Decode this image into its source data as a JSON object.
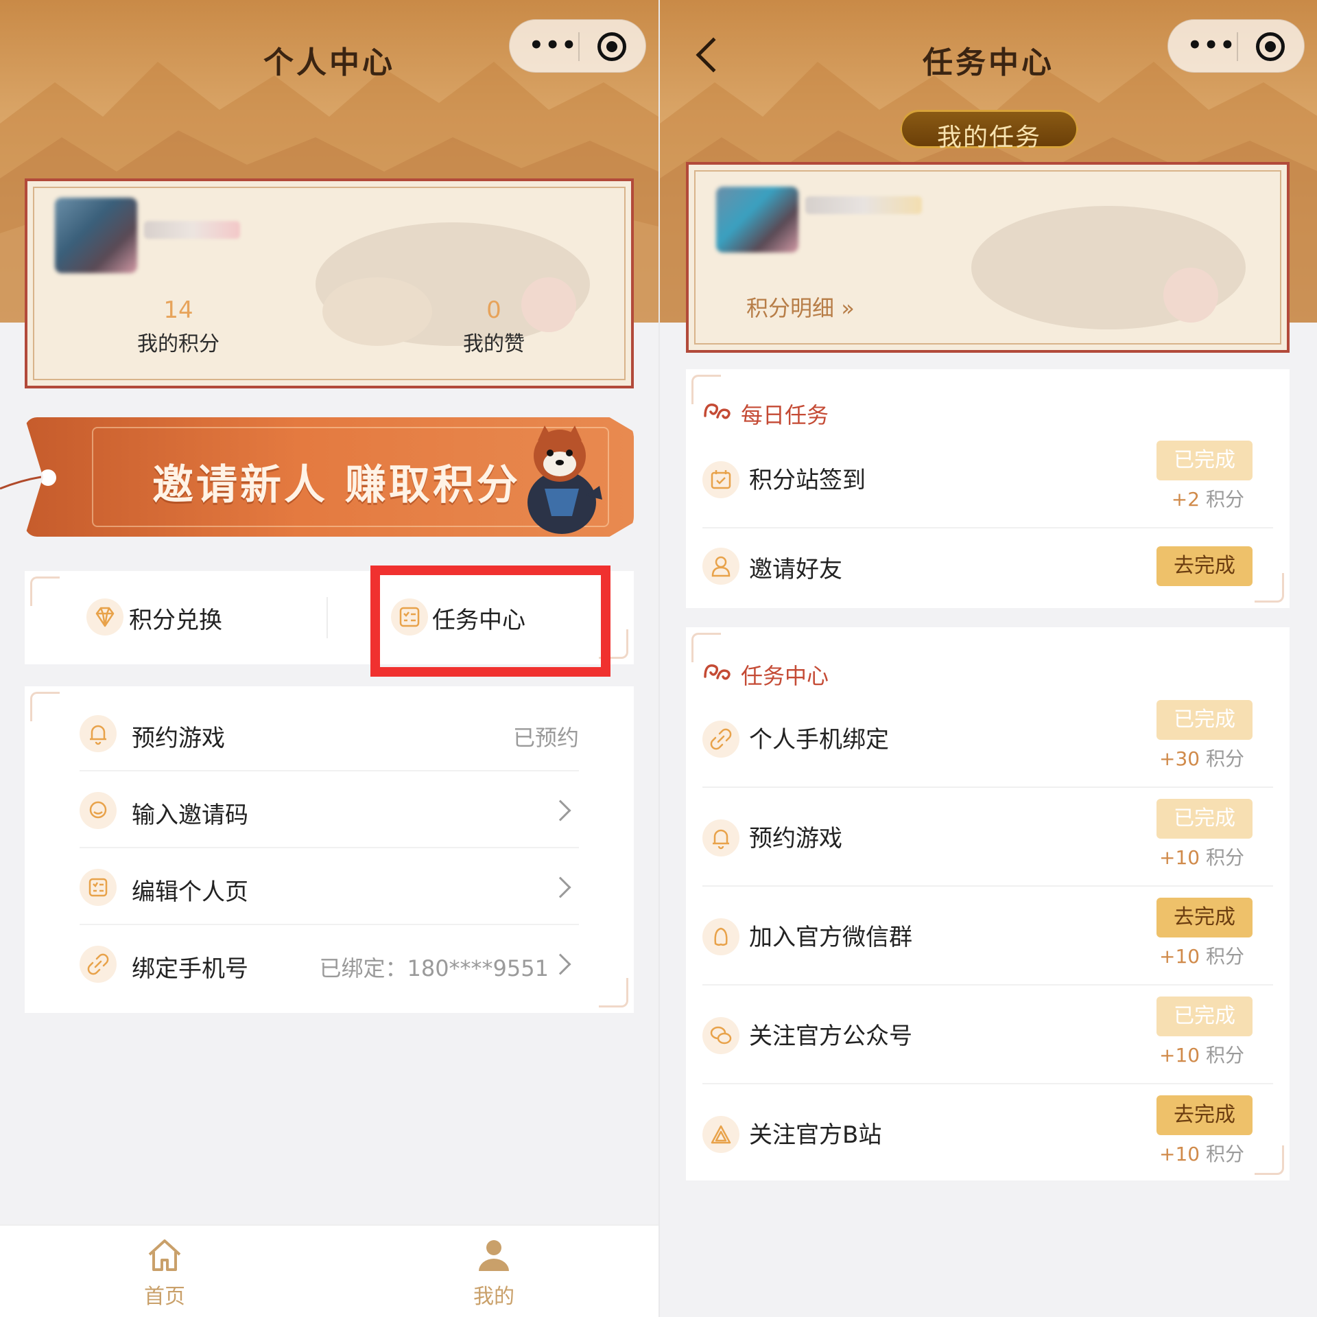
{
  "left": {
    "nav_title": "个人中心",
    "stats": [
      {
        "value": "14",
        "label": "我的积分"
      },
      {
        "value": "0",
        "label": "我的赞"
      }
    ],
    "banner_text": "邀请新人  赚取积分",
    "quick_actions": [
      {
        "label": "积分兑换",
        "icon": "diamond-icon"
      },
      {
        "label": "任务中心",
        "icon": "task-list-icon"
      }
    ],
    "menu": [
      {
        "label": "预约游戏",
        "value": "已预约",
        "icon": "bell-icon",
        "chevron": false
      },
      {
        "label": "输入邀请码",
        "value": "",
        "icon": "chat-bubble-icon",
        "chevron": true
      },
      {
        "label": "编辑个人页",
        "value": "",
        "icon": "edit-list-icon",
        "chevron": true
      },
      {
        "label": "绑定手机号",
        "value": "已绑定：180****9551",
        "icon": "link-icon",
        "chevron": true
      }
    ],
    "tabs": [
      {
        "label": "首页",
        "icon": "home-icon"
      },
      {
        "label": "我的",
        "icon": "user-icon"
      }
    ]
  },
  "right": {
    "nav_title": "任务中心",
    "badge": "我的任务",
    "detail_link": "积分明细",
    "detail_chevrons": "»",
    "daily": {
      "title": "每日任务",
      "tasks": [
        {
          "name": "积分站签到",
          "status": "已完成",
          "state": "done",
          "points": "+2",
          "unit": "积分",
          "icon": "calendar-check-icon"
        },
        {
          "name": "邀请好友",
          "status": "去完成",
          "state": "todo",
          "points": "",
          "unit": "",
          "icon": "user-icon"
        }
      ]
    },
    "center": {
      "title": "任务中心",
      "tasks": [
        {
          "name": "个人手机绑定",
          "status": "已完成",
          "state": "done",
          "points": "+30",
          "unit": "积分",
          "icon": "link-icon"
        },
        {
          "name": "预约游戏",
          "status": "已完成",
          "state": "done",
          "points": "+10",
          "unit": "积分",
          "icon": "bell-icon"
        },
        {
          "name": "加入官方微信群",
          "status": "去完成",
          "state": "todo",
          "points": "+10",
          "unit": "积分",
          "icon": "qq-penguin-icon"
        },
        {
          "name": "关注官方公众号",
          "status": "已完成",
          "state": "done",
          "points": "+10",
          "unit": "积分",
          "icon": "wechat-icon"
        },
        {
          "name": "关注官方B站",
          "status": "去完成",
          "state": "todo",
          "points": "+10",
          "unit": "积分",
          "icon": "bilibili-icon"
        }
      ]
    }
  },
  "colors": {
    "accent_orange": "#e47a40",
    "highlight_red": "#f0312f",
    "done_button": "#f7dfb2",
    "todo_button": "#eec16a",
    "section_title": "#c44a34"
  }
}
